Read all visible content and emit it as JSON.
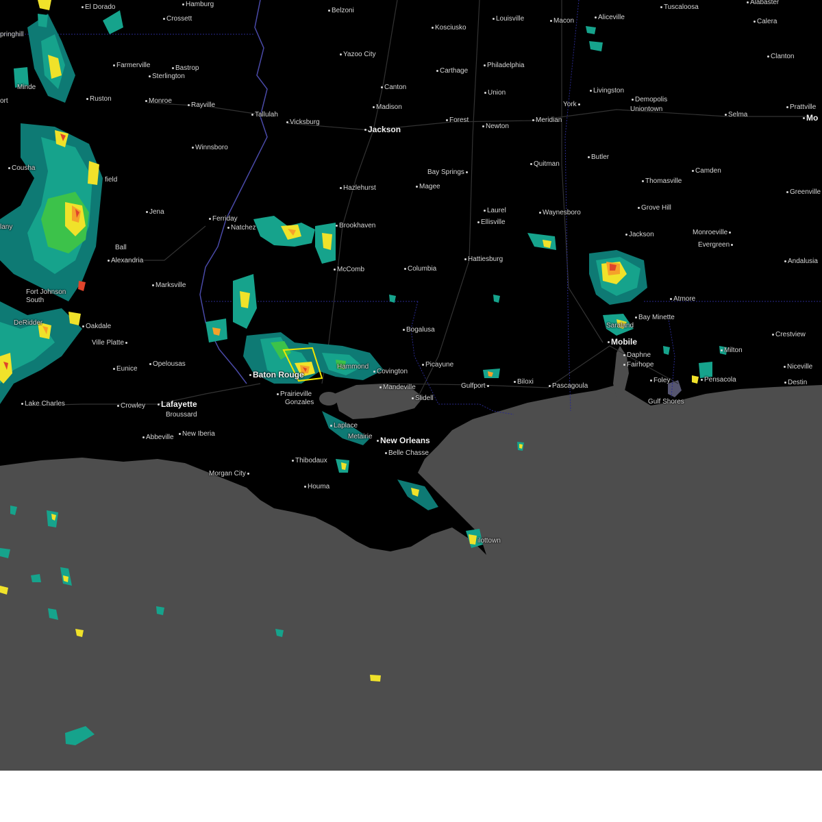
{
  "map": {
    "colors": {
      "land": "#000000",
      "water": "#4d4d4d",
      "roads": "#3a3a3a",
      "state_border": "#2a2a8f",
      "river": "#4a4aa8",
      "warning_polygon": "#f2e600",
      "radar_scale": [
        "#0e7a74",
        "#16a38c",
        "#3cc24a",
        "#f0e22a",
        "#f5a12a",
        "#e0442b",
        "#b01c1c"
      ]
    },
    "cities": [
      {
        "id": "el-dorado",
        "name": "El Dorado"
      },
      {
        "id": "hamburg",
        "name": "Hamburg"
      },
      {
        "id": "crossett",
        "name": "Crossett"
      },
      {
        "id": "belzoni",
        "name": "Belzoni"
      },
      {
        "id": "kosciusko",
        "name": "Kosciusko"
      },
      {
        "id": "louisville",
        "name": "Louisville"
      },
      {
        "id": "macon",
        "name": "Macon"
      },
      {
        "id": "aliceville",
        "name": "Aliceville"
      },
      {
        "id": "tuscaloosa",
        "name": "Tuscaloosa"
      },
      {
        "id": "alabaster",
        "name": "Alabaster"
      },
      {
        "id": "calera",
        "name": "Calera"
      },
      {
        "id": "springhill",
        "name": "pringhill"
      },
      {
        "id": "yazoo-city",
        "name": "Yazoo City"
      },
      {
        "id": "farmerville",
        "name": "Farmerville"
      },
      {
        "id": "bastrop",
        "name": "Bastrop"
      },
      {
        "id": "sterlington",
        "name": "Sterlington"
      },
      {
        "id": "carthage",
        "name": "Carthage"
      },
      {
        "id": "philadelphia",
        "name": "Philadelphia"
      },
      {
        "id": "clanton",
        "name": "Clanton"
      },
      {
        "id": "canton",
        "name": "Canton"
      },
      {
        "id": "union",
        "name": "Union"
      },
      {
        "id": "livingston",
        "name": "Livingston"
      },
      {
        "id": "minden",
        "name": "Minde"
      },
      {
        "id": "ruston",
        "name": "Ruston"
      },
      {
        "id": "monroe",
        "name": "Monroe"
      },
      {
        "id": "rayville",
        "name": "Rayville"
      },
      {
        "id": "madison",
        "name": "Madison"
      },
      {
        "id": "york",
        "name": "York"
      },
      {
        "id": "demopolis",
        "name": "Demopolis"
      },
      {
        "id": "uniontown",
        "name": "Uniontown"
      },
      {
        "id": "prattville",
        "name": "Prattville"
      },
      {
        "id": "shreveport",
        "name": "ort"
      },
      {
        "id": "tallulah",
        "name": "Tallulah"
      },
      {
        "id": "vicksburg",
        "name": "Vicksburg"
      },
      {
        "id": "jackson-ms",
        "name": "Jackson"
      },
      {
        "id": "forest",
        "name": "Forest"
      },
      {
        "id": "newton",
        "name": "Newton"
      },
      {
        "id": "meridian",
        "name": "Meridian"
      },
      {
        "id": "selma",
        "name": "Selma"
      },
      {
        "id": "montgomery",
        "name": "Mo"
      },
      {
        "id": "winnsboro",
        "name": "Winnsboro"
      },
      {
        "id": "butler",
        "name": "Butler"
      },
      {
        "id": "quitman",
        "name": "Quitman"
      },
      {
        "id": "bay-springs",
        "name": "Bay Springs"
      },
      {
        "id": "coushatta",
        "name": "Cousha"
      },
      {
        "id": "camden",
        "name": "Camden"
      },
      {
        "id": "field",
        "name": "field"
      },
      {
        "id": "hazlehurst",
        "name": "Hazlehurst"
      },
      {
        "id": "magee",
        "name": "Magee"
      },
      {
        "id": "thomasville",
        "name": "Thomasville"
      },
      {
        "id": "greenville",
        "name": "Greenville"
      },
      {
        "id": "jena",
        "name": "Jena"
      },
      {
        "id": "laurel",
        "name": "Laurel"
      },
      {
        "id": "waynesboro",
        "name": "Waynesboro"
      },
      {
        "id": "grove-hill",
        "name": "Grove Hill"
      },
      {
        "id": "ferriday",
        "name": "Ferriday"
      },
      {
        "id": "natchez",
        "name": "Natchez"
      },
      {
        "id": "brookhaven",
        "name": "Brookhaven"
      },
      {
        "id": "ellisville",
        "name": "Ellisville"
      },
      {
        "id": "leesville",
        "name": "lany"
      },
      {
        "id": "jackson-al",
        "name": "Jackson"
      },
      {
        "id": "monroeville",
        "name": "Monroeville"
      },
      {
        "id": "ball",
        "name": "Ball"
      },
      {
        "id": "evergreen",
        "name": "Evergreen"
      },
      {
        "id": "alexandria",
        "name": "Alexandria"
      },
      {
        "id": "hattiesburg",
        "name": "Hattiesburg"
      },
      {
        "id": "andalusia",
        "name": "Andalusia"
      },
      {
        "id": "mccomb",
        "name": "McComb"
      },
      {
        "id": "columbia",
        "name": "Columbia"
      },
      {
        "id": "marksville",
        "name": "Marksville"
      },
      {
        "id": "fort-johnson",
        "name": "Fort Johnson South"
      },
      {
        "id": "atmore",
        "name": "Atmore"
      },
      {
        "id": "bay-minette",
        "name": "Bay Minette"
      },
      {
        "id": "deridder",
        "name": "DeRidder"
      },
      {
        "id": "oakdale",
        "name": "Oakdale"
      },
      {
        "id": "bogalusa",
        "name": "Bogalusa"
      },
      {
        "id": "saraland",
        "name": "Saraland"
      },
      {
        "id": "crestview",
        "name": "Crestview"
      },
      {
        "id": "ville-platte",
        "name": "Ville Platte"
      },
      {
        "id": "mobile",
        "name": "Mobile"
      },
      {
        "id": "milton",
        "name": "Milton"
      },
      {
        "id": "daphne",
        "name": "Daphne"
      },
      {
        "id": "opelousas",
        "name": "Opelousas"
      },
      {
        "id": "hammond",
        "name": "Hammond"
      },
      {
        "id": "picayune",
        "name": "Picayune"
      },
      {
        "id": "fairhope",
        "name": "Fairhope"
      },
      {
        "id": "niceville",
        "name": "Niceville"
      },
      {
        "id": "eunice",
        "name": "Eunice"
      },
      {
        "id": "baton-rouge",
        "name": "Baton Rouge"
      },
      {
        "id": "covington",
        "name": "Covington"
      },
      {
        "id": "biloxi",
        "name": "Biloxi"
      },
      {
        "id": "pensacola",
        "name": "Pensacola"
      },
      {
        "id": "foley",
        "name": "Foley"
      },
      {
        "id": "destin",
        "name": "Destin"
      },
      {
        "id": "mandeville",
        "name": "Mandeville"
      },
      {
        "id": "gulfport",
        "name": "Gulfport"
      },
      {
        "id": "pascagoula",
        "name": "Pascagoula"
      },
      {
        "id": "prairieville",
        "name": "Prairieville"
      },
      {
        "id": "slidell",
        "name": "Slidell"
      },
      {
        "id": "gonzales",
        "name": "Gonzales"
      },
      {
        "id": "gulf-shores",
        "name": "Gulf Shores"
      },
      {
        "id": "lake-charles",
        "name": "Lake Charles"
      },
      {
        "id": "crowley",
        "name": "Crowley"
      },
      {
        "id": "lafayette",
        "name": "Lafayette"
      },
      {
        "id": "broussard",
        "name": "Broussard"
      },
      {
        "id": "laplace",
        "name": "Laplace"
      },
      {
        "id": "metairie",
        "name": "Metairie"
      },
      {
        "id": "new-orleans",
        "name": "New Orleans"
      },
      {
        "id": "abbeville",
        "name": "Abbeville"
      },
      {
        "id": "new-iberia",
        "name": "New Iberia"
      },
      {
        "id": "belle-chasse",
        "name": "Belle Chasse"
      },
      {
        "id": "thibodaux",
        "name": "Thibodaux"
      },
      {
        "id": "morgan-city",
        "name": "Morgan City"
      },
      {
        "id": "houma",
        "name": "Houma"
      },
      {
        "id": "pilottown",
        "name": "ilottown"
      }
    ]
  }
}
